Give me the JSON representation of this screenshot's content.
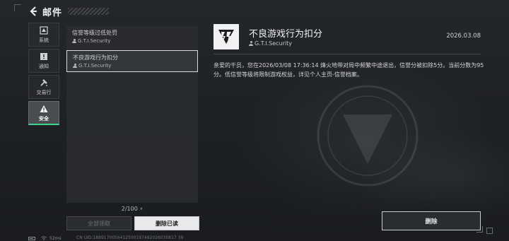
{
  "header": {
    "title": "邮件"
  },
  "sidebar": {
    "items": [
      {
        "label": "系统",
        "icon": "system-icon"
      },
      {
        "label": "通知",
        "icon": "notice-icon"
      },
      {
        "label": "交易行",
        "icon": "trade-icon"
      },
      {
        "label": "安全",
        "icon": "warning-icon",
        "active": true
      }
    ]
  },
  "mail_list": {
    "items": [
      {
        "subject": "信誉等级过低处罚",
        "sender": "G.T.I.Security"
      },
      {
        "subject": "不良游戏行为扣分",
        "sender": "G.T.I.Security",
        "selected": true
      }
    ],
    "counter": "2/100",
    "claim_all_label": "全部领取",
    "delete_read_label": "删除已读"
  },
  "detail": {
    "title": "不良游戏行为扣分",
    "sender": "G.T.I.Security",
    "date": "2026.03.08",
    "body": "亲爱的干员，您在2026/03/08 17:36:14 烽火地带对局中频繁中途退出，信誉分被扣除5分。当前分数为95分。低信誉等级将限制游戏权益，详见个人主页-信誉档案。",
    "delete_label": "删除"
  },
  "status_bar": {
    "latency": "52ms",
    "uid": "CN UID:1889170056412500197492026030817 39"
  },
  "colors": {
    "accent": "#3fd38a"
  }
}
